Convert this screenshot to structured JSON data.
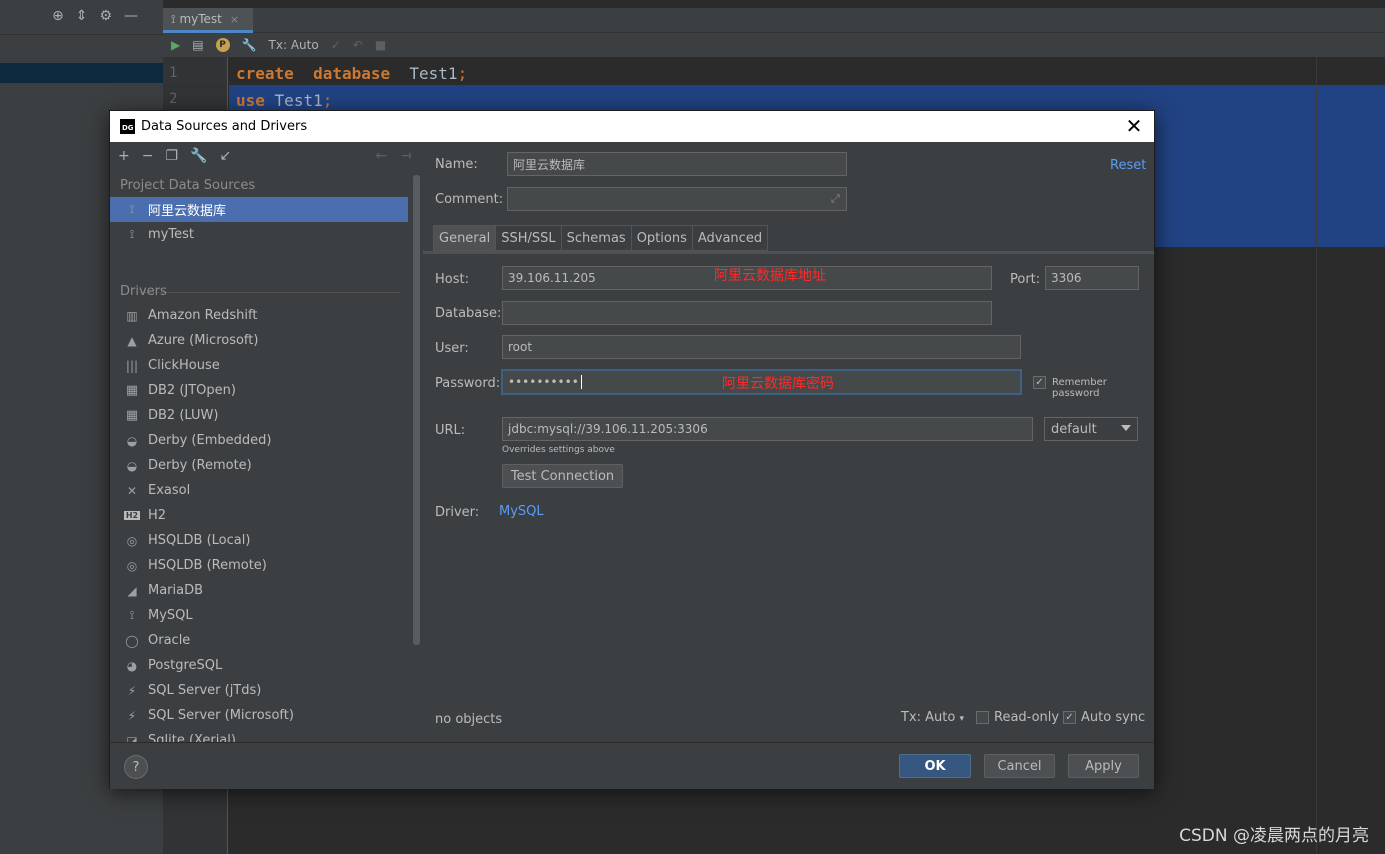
{
  "ide": {
    "tab_label": "myTest",
    "tab_close": "×",
    "toolbar": {
      "tx": "Tx: Auto"
    },
    "line_numbers": [
      "1",
      "2"
    ],
    "code": [
      {
        "kw1": "create",
        "kw2": "database",
        "rest": "Test1",
        "semi": ";"
      },
      {
        "kw1": "use",
        "rest": "Test1",
        "semi": ";"
      }
    ],
    "watermark": "CSDN @凌晨两点的月亮"
  },
  "dialog": {
    "title": "Data Sources and Drivers",
    "logo": "DG",
    "close": "✕",
    "left": {
      "project_section": "Project Data Sources",
      "projects": [
        {
          "label": "阿里云数据库",
          "icon": "mysql-icon",
          "glyph": "⟟"
        },
        {
          "label": "myTest",
          "icon": "mysql-icon",
          "glyph": "⟟"
        }
      ],
      "drivers_section": "Drivers",
      "drivers": [
        {
          "label": "Amazon Redshift",
          "icon": "redshift-icon",
          "glyph": "▥"
        },
        {
          "label": "Azure (Microsoft)",
          "icon": "azure-icon",
          "glyph": "▲"
        },
        {
          "label": "ClickHouse",
          "icon": "clickhouse-icon",
          "glyph": "|||"
        },
        {
          "label": "DB2 (JTOpen)",
          "icon": "db2-icon",
          "glyph": "▦"
        },
        {
          "label": "DB2 (LUW)",
          "icon": "db2-icon",
          "glyph": "▦"
        },
        {
          "label": "Derby (Embedded)",
          "icon": "derby-icon",
          "glyph": "◒"
        },
        {
          "label": "Derby (Remote)",
          "icon": "derby-icon",
          "glyph": "◒"
        },
        {
          "label": "Exasol",
          "icon": "exasol-icon",
          "glyph": "✕"
        },
        {
          "label": "H2",
          "icon": "h2-icon",
          "glyph": "H2"
        },
        {
          "label": "HSQLDB (Local)",
          "icon": "hsqldb-icon",
          "glyph": "◎"
        },
        {
          "label": "HSQLDB (Remote)",
          "icon": "hsqldb-icon",
          "glyph": "◎"
        },
        {
          "label": "MariaDB",
          "icon": "mariadb-icon",
          "glyph": "◢"
        },
        {
          "label": "MySQL",
          "icon": "mysql-icon",
          "glyph": "⟟"
        },
        {
          "label": "Oracle",
          "icon": "oracle-icon",
          "glyph": "◯"
        },
        {
          "label": "PostgreSQL",
          "icon": "postgresql-icon",
          "glyph": "◕"
        },
        {
          "label": "SQL Server (jTds)",
          "icon": "sqlserver-icon",
          "glyph": "⚡"
        },
        {
          "label": "SQL Server (Microsoft)",
          "icon": "sqlserver-icon",
          "glyph": "⚡"
        },
        {
          "label": "Sqlite (Xerial)",
          "icon": "sqlite-icon",
          "glyph": "◪"
        }
      ]
    },
    "form": {
      "name_label": "Name:",
      "name_value": "阿里云数据库",
      "comment_label": "Comment:",
      "comment_value": "",
      "reset": "Reset",
      "tabs": [
        "General",
        "SSH/SSL",
        "Schemas",
        "Options",
        "Advanced"
      ],
      "host_label": "Host:",
      "host_value": "39.106.11.205",
      "host_annotation": "阿里云数据库地址",
      "port_label": "Port:",
      "port_value": "3306",
      "database_label": "Database:",
      "database_value": "",
      "user_label": "User:",
      "user_value": "root",
      "password_label": "Password:",
      "password_value": "••••••••••",
      "password_annotation": "阿里云数据库密码",
      "remember_label": "Remember password",
      "remember_checked": true,
      "url_label": "URL:",
      "url_value": "jdbc:mysql://39.106.11.205:3306",
      "url_mode": "default",
      "overrides_note": "Overrides settings above",
      "test_connection": "Test Connection",
      "driver_label": "Driver:",
      "driver_value": "MySQL",
      "status": "no objects",
      "tx_mode": "Tx: Auto",
      "readonly_label": "Read-only",
      "readonly_checked": false,
      "autosync_label": "Auto sync",
      "autosync_checked": true
    },
    "footer": {
      "help": "?",
      "ok": "OK",
      "cancel": "Cancel",
      "apply": "Apply"
    }
  }
}
